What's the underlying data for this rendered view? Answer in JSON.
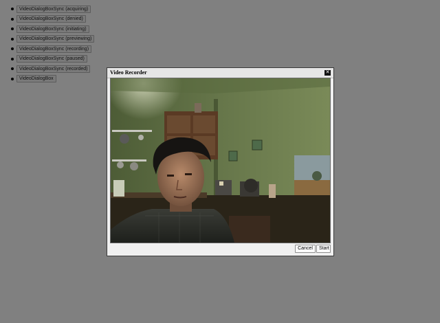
{
  "demo_buttons": [
    {
      "label": "VideoDialogBoxSync (acquiring)"
    },
    {
      "label": "VideoDialogBoxSync (denied)"
    },
    {
      "label": "VideoDialogBoxSync (initiating)"
    },
    {
      "label": "VideoDialogBoxSync (previewing)"
    },
    {
      "label": "VideoDialogBoxSync (recording)"
    },
    {
      "label": "VideoDialogBoxSync (paused)"
    },
    {
      "label": "VideoDialogBoxSync (recorded)"
    },
    {
      "label": "VideoDialogBox"
    }
  ],
  "dialog": {
    "title": "Video Recorder",
    "close_glyph": "✕",
    "cancel_label": "Cancel",
    "start_label": "Start"
  },
  "colors": {
    "page_background": "#808080",
    "dialog_background": "#f0f0f0"
  }
}
